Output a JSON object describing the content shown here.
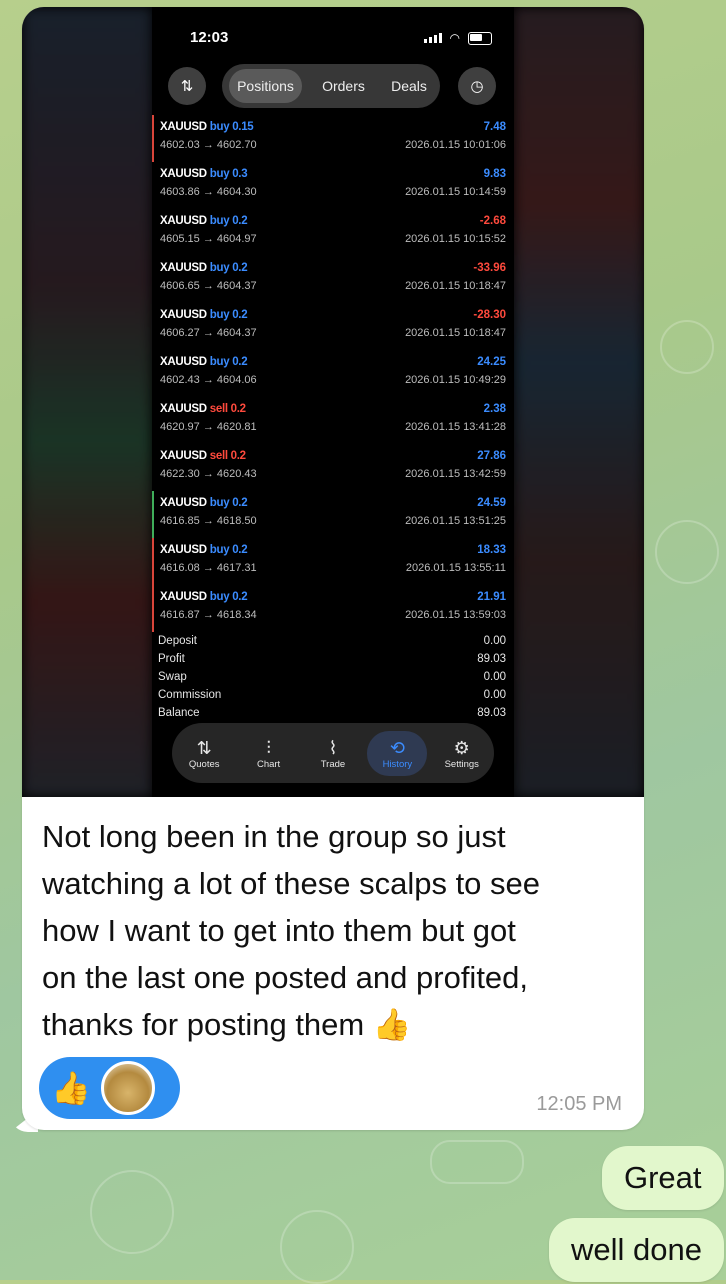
{
  "phone": {
    "status_time": "12:03",
    "tabs": [
      "Positions",
      "Orders",
      "Deals"
    ],
    "active_tab": "Positions",
    "trades": [
      {
        "symbol": "XAUUSD",
        "side": "buy 0.15",
        "prices": "4602.03 → 4602.70",
        "profit": "7.48",
        "time": "2026.01.15 10:01:06",
        "mark": "red"
      },
      {
        "symbol": "XAUUSD",
        "side": "buy 0.3",
        "prices": "4603.86 → 4604.30",
        "profit": "9.83",
        "time": "2026.01.15 10:14:59",
        "mark": ""
      },
      {
        "symbol": "XAUUSD",
        "side": "buy 0.2",
        "prices": "4605.15 → 4604.97",
        "profit": "-2.68",
        "time": "2026.01.15 10:15:52",
        "mark": ""
      },
      {
        "symbol": "XAUUSD",
        "side": "buy 0.2",
        "prices": "4606.65 → 4604.37",
        "profit": "-33.96",
        "time": "2026.01.15 10:18:47",
        "mark": ""
      },
      {
        "symbol": "XAUUSD",
        "side": "buy 0.2",
        "prices": "4606.27 → 4604.37",
        "profit": "-28.30",
        "time": "2026.01.15 10:18:47",
        "mark": ""
      },
      {
        "symbol": "XAUUSD",
        "side": "buy 0.2",
        "prices": "4602.43 → 4604.06",
        "profit": "24.25",
        "time": "2026.01.15 10:49:29",
        "mark": ""
      },
      {
        "symbol": "XAUUSD",
        "side": "sell 0.2",
        "prices": "4620.97 → 4620.81",
        "profit": "2.38",
        "time": "2026.01.15 13:41:28",
        "mark": ""
      },
      {
        "symbol": "XAUUSD",
        "side": "sell 0.2",
        "prices": "4622.30 → 4620.43",
        "profit": "27.86",
        "time": "2026.01.15 13:42:59",
        "mark": ""
      },
      {
        "symbol": "XAUUSD",
        "side": "buy 0.2",
        "prices": "4616.85 → 4618.50",
        "profit": "24.59",
        "time": "2026.01.15 13:51:25",
        "mark": "green"
      },
      {
        "symbol": "XAUUSD",
        "side": "buy 0.2",
        "prices": "4616.08 → 4617.31",
        "profit": "18.33",
        "time": "2026.01.15 13:55:11",
        "mark": "red"
      },
      {
        "symbol": "XAUUSD",
        "side": "buy 0.2",
        "prices": "4616.87 → 4618.34",
        "profit": "21.91",
        "time": "2026.01.15 13:59:03",
        "mark": "red"
      }
    ],
    "summary": [
      {
        "label": "Deposit",
        "value": "0.00"
      },
      {
        "label": "Profit",
        "value": "89.03"
      },
      {
        "label": "Swap",
        "value": "0.00"
      },
      {
        "label": "Commission",
        "value": "0.00"
      },
      {
        "label": "Balance",
        "value": "89.03"
      }
    ],
    "nav": [
      {
        "label": "Quotes",
        "icon": "quotes-icon"
      },
      {
        "label": "Chart",
        "icon": "chart-icon"
      },
      {
        "label": "Trade",
        "icon": "trade-icon"
      },
      {
        "label": "History",
        "icon": "history-icon"
      },
      {
        "label": "Settings",
        "icon": "settings-icon"
      }
    ],
    "active_nav": "History"
  },
  "message": {
    "lines": [
      "Not long been in the group so just",
      "watching a lot of these scalps to see",
      "how I want to get into them but got",
      "on the last one posted and profited,",
      "thanks for posting them 👍"
    ],
    "time": "12:05 PM",
    "reaction_emoji": "👍"
  },
  "outgoing": [
    {
      "text": "Great"
    },
    {
      "text": "well done"
    }
  ],
  "colors": {
    "buy": "#3b8cff",
    "sell": "#ff4a3d",
    "reaction_bg": "#2f8ff0",
    "outgoing_bubble": "#e2f7cc"
  }
}
